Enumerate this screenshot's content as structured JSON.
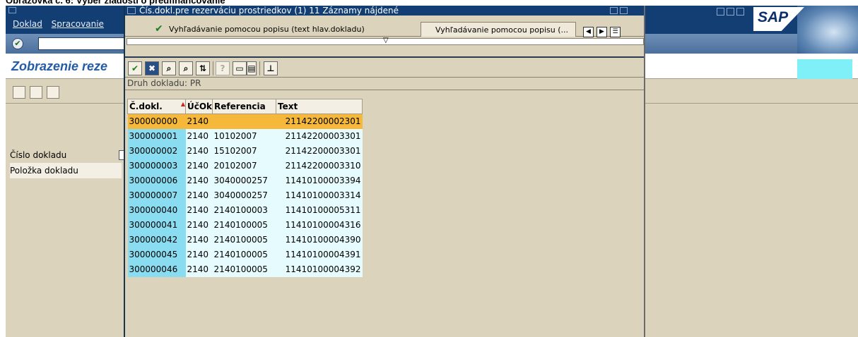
{
  "caption": "Obrazovka č. 6:  Výber žiadostí o predfinancovanie",
  "main_window": {
    "menu": [
      "Doklad",
      "Spracovanie"
    ],
    "logo": "SAP",
    "screen_title": "Zobrazenie reze",
    "fields": [
      "Číslo dokladu",
      "Položka dokladu"
    ]
  },
  "popup": {
    "title": "Čís.dokl.pre rezerváciu prostriedkov (1)   11 Záznamy nájdené",
    "tabs": {
      "active": "Vyhľadávanie pomocou popisu (text hlav.dokladu)",
      "inactive": "Vyhľadávanie pomocou popisu (..."
    },
    "group_label": "Druh dokladu: PR",
    "columns": [
      "Č.dokl.",
      "ÚčOk",
      "Referencia",
      "Text"
    ],
    "rows": [
      [
        "300000000",
        "2140",
        "",
        "21142200002301"
      ],
      [
        "300000001",
        "2140",
        "10102007",
        "21142200003301"
      ],
      [
        "300000002",
        "2140",
        "15102007",
        "21142200003301"
      ],
      [
        "300000003",
        "2140",
        "20102007",
        "21142200003310"
      ],
      [
        "300000006",
        "2140",
        "3040000257",
        "11410100003394"
      ],
      [
        "300000007",
        "2140",
        "3040000257",
        "11410100003314"
      ],
      [
        "300000040",
        "2140",
        "2140100003",
        "11410100005311"
      ],
      [
        "300000041",
        "2140",
        "2140100005",
        "11410100004316"
      ],
      [
        "300000042",
        "2140",
        "2140100005",
        "11410100004390"
      ],
      [
        "300000045",
        "2140",
        "2140100005",
        "11410100004391"
      ],
      [
        "300000046",
        "2140",
        "2140100005",
        "11410100004392"
      ]
    ],
    "selected_row": 0
  },
  "colors": {
    "title_bar": "#123e73",
    "background": "#dcd3bd",
    "selected_row": "#f5b83a",
    "key_column": "#8adcf0",
    "row_bg": "#e6fbfd",
    "screen_title": "#245da6"
  },
  "icons": {
    "toolbar": [
      "check-icon",
      "cancel-icon",
      "find-icon",
      "find-next-icon",
      "sort-icon",
      "help-icon",
      "print-icon",
      "layout-icon",
      "filter-icon"
    ]
  }
}
